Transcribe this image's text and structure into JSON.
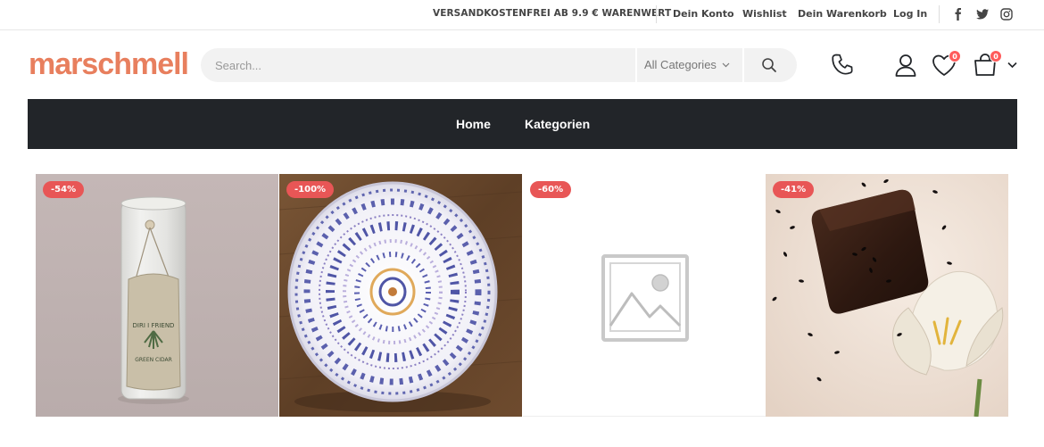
{
  "topbar": {
    "shipping": "VERSANDKOSTENFREI AB 9.9 € WARENWERT",
    "links": [
      "Dein Konto",
      "Wishlist",
      "Dein Warenkorb",
      "Log In"
    ]
  },
  "header": {
    "logo": "marschmell",
    "search_placeholder": "Search...",
    "category": "All Categories",
    "wishlist_count": "0",
    "cart_count": "0"
  },
  "nav": {
    "items": [
      "Home",
      "Kategorien"
    ]
  },
  "products": [
    {
      "sale": "-54%"
    },
    {
      "sale": "-100%"
    },
    {
      "sale": "-60%"
    },
    {
      "sale": "-41%"
    }
  ],
  "colors": {
    "brand": "#e87f5e",
    "nav_bg": "#222529",
    "sale_badge": "#e85656"
  }
}
